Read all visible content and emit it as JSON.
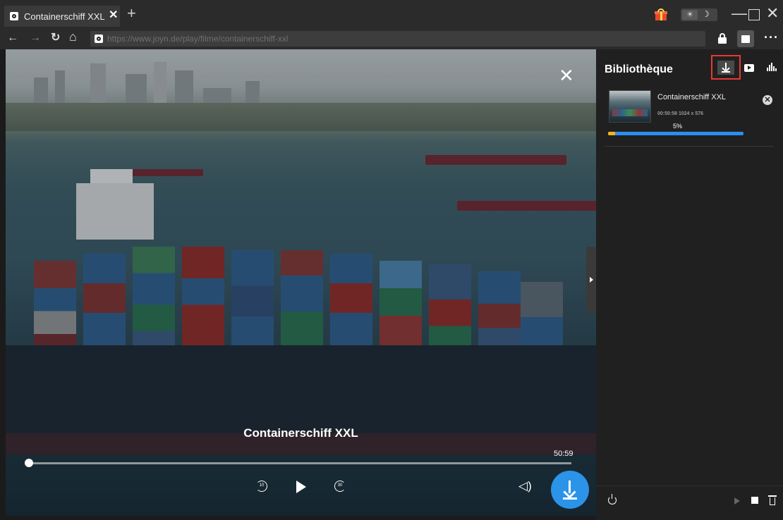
{
  "tab": {
    "title": "Containerschiff XXL s",
    "close_glyph": "✕",
    "new_glyph": "+"
  },
  "window": {
    "min_glyph": "—",
    "close_glyph": "✕"
  },
  "nav": {
    "back": "←",
    "forward": "→",
    "reload": "↻",
    "home": "⌂",
    "url": "https://www.joyn.de/play/filme/containerschiff-xxl",
    "more": "···"
  },
  "player": {
    "title": "Containerschiff XXL",
    "duration": "50:59",
    "progress_fraction": 0.01,
    "rewind_label": "10",
    "forward_label": "30",
    "volume_glyph": "◁)",
    "close_glyph": "✕"
  },
  "panel": {
    "title": "Bibliothèque",
    "item": {
      "name": "Containerschiff XXL",
      "meta": "00:50:58   1024 x 576",
      "progress_text": "5%",
      "progress_fraction": 0.05,
      "remove_glyph": "✕"
    }
  },
  "colors": {
    "accent": "#2b93e8",
    "progress": "#2b8ff2",
    "progress_fill": "#f5b21b",
    "highlight": "#e53935"
  }
}
